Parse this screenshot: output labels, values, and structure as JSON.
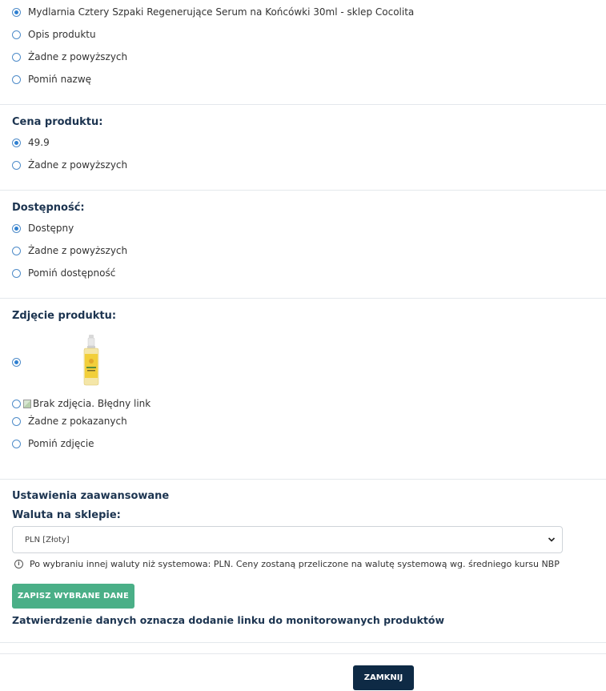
{
  "name_section": {
    "options": [
      {
        "label": "Mydlarnia Cztery Szpaki Regenerujące Serum na Końcówki 30ml - sklep Cocolita",
        "checked": true
      },
      {
        "label": "Opis produktu",
        "checked": false
      },
      {
        "label": "Żadne z powyższych",
        "checked": false
      },
      {
        "label": "Pomiń nazwę",
        "checked": false
      }
    ]
  },
  "price_section": {
    "heading": "Cena produktu:",
    "options": [
      {
        "label": "49.9",
        "checked": true
      },
      {
        "label": "Żadne z powyższych",
        "checked": false
      }
    ]
  },
  "availability_section": {
    "heading": "Dostępność:",
    "options": [
      {
        "label": "Dostępny",
        "checked": true
      },
      {
        "label": "Żadne z powyższych",
        "checked": false
      },
      {
        "label": "Pomiń dostępność",
        "checked": false
      }
    ]
  },
  "image_section": {
    "heading": "Zdjęcie produktu:",
    "broken_image_alt": "Brak zdjęcia. Błędny link",
    "options": [
      {
        "label": "Żadne z pokazanych",
        "checked": false
      },
      {
        "label": "Pomiń zdjęcie",
        "checked": false
      }
    ]
  },
  "advanced": {
    "heading": "Ustawienia zaawansowane",
    "currency_label": "Waluta na sklepie:",
    "currency_selected": "PLN [Złoty]",
    "info_text": "Po wybraniu innej waluty niż systemowa: PLN. Ceny zostaną przeliczone na walutę systemową wg. średniego kursu NBP",
    "save_button": "ZAPISZ WYBRANE DANE",
    "confirm_note": "Zatwierdzenie danych oznacza dodanie linku do monitorowanych produktów"
  },
  "footer": {
    "close_button": "ZAMKNIJ"
  },
  "colors": {
    "accent_blue": "#2f80d1",
    "save_green": "#4aaf87",
    "close_navy": "#0e2a45",
    "heading_navy": "#1c3450"
  }
}
